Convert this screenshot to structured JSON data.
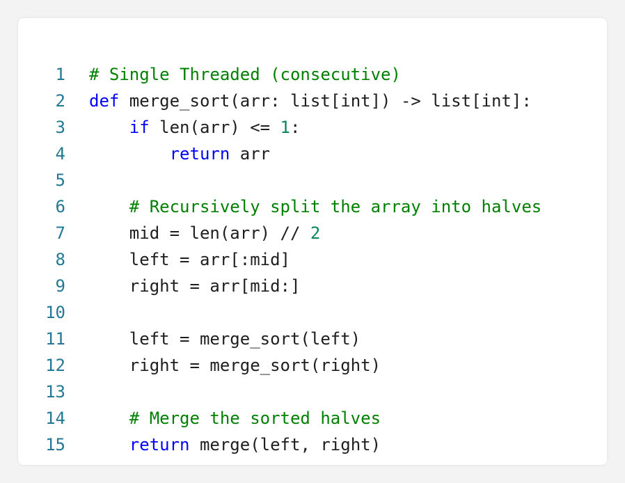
{
  "colors": {
    "background": "#f3f3f3",
    "card": "#ffffff",
    "text": "#1e1e1e",
    "line_number": "#237893",
    "keyword": "#0000ff",
    "comment": "#008000",
    "number": "#098658"
  },
  "lines": [
    {
      "num": "1",
      "tokens": [
        {
          "t": "# Single Threaded (consecutive)",
          "k": "cm"
        }
      ]
    },
    {
      "num": "2",
      "tokens": [
        {
          "t": "def",
          "k": "kw"
        },
        {
          "t": " merge_sort(arr: list[int]) -> list[int]:",
          "k": "tx"
        }
      ]
    },
    {
      "num": "3",
      "tokens": [
        {
          "t": "    ",
          "k": "tx"
        },
        {
          "t": "if",
          "k": "kw"
        },
        {
          "t": " len(arr) <= ",
          "k": "tx"
        },
        {
          "t": "1",
          "k": "num"
        },
        {
          "t": ":",
          "k": "tx"
        }
      ]
    },
    {
      "num": "4",
      "tokens": [
        {
          "t": "        ",
          "k": "tx"
        },
        {
          "t": "return",
          "k": "kw"
        },
        {
          "t": " arr",
          "k": "tx"
        }
      ]
    },
    {
      "num": "5",
      "tokens": []
    },
    {
      "num": "6",
      "tokens": [
        {
          "t": "    ",
          "k": "tx"
        },
        {
          "t": "# Recursively split the array into halves",
          "k": "cm"
        }
      ]
    },
    {
      "num": "7",
      "tokens": [
        {
          "t": "    mid = len(arr) // ",
          "k": "tx"
        },
        {
          "t": "2",
          "k": "num"
        }
      ]
    },
    {
      "num": "8",
      "tokens": [
        {
          "t": "    left = arr[:mid]",
          "k": "tx"
        }
      ]
    },
    {
      "num": "9",
      "tokens": [
        {
          "t": "    right = arr[mid:]",
          "k": "tx"
        }
      ]
    },
    {
      "num": "10",
      "tokens": []
    },
    {
      "num": "11",
      "tokens": [
        {
          "t": "    left = merge_sort(left)",
          "k": "tx"
        }
      ]
    },
    {
      "num": "12",
      "tokens": [
        {
          "t": "    right = merge_sort(right)",
          "k": "tx"
        }
      ]
    },
    {
      "num": "13",
      "tokens": []
    },
    {
      "num": "14",
      "tokens": [
        {
          "t": "    ",
          "k": "tx"
        },
        {
          "t": "# Merge the sorted halves",
          "k": "cm"
        }
      ]
    },
    {
      "num": "15",
      "tokens": [
        {
          "t": "    ",
          "k": "tx"
        },
        {
          "t": "return",
          "k": "kw"
        },
        {
          "t": " merge(left, right)",
          "k": "tx"
        }
      ]
    }
  ]
}
